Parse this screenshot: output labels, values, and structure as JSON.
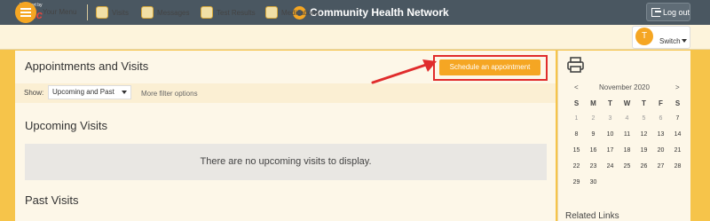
{
  "header": {
    "logo": {
      "small_text": "MyChart by",
      "brand_text": "Epic"
    },
    "brand_name": "Community Health Network",
    "logout_label": "Log out"
  },
  "nav": {
    "your_menu": "Your Menu",
    "items": [
      {
        "label": "Visits",
        "icon": "visits-icon"
      },
      {
        "label": "Messages",
        "icon": "messages-icon"
      },
      {
        "label": "Test Results",
        "icon": "test-results-icon"
      },
      {
        "label": "Medications",
        "icon": "medications-icon"
      }
    ],
    "switch": {
      "avatar_letter": "T",
      "label": "Switch"
    }
  },
  "main": {
    "title": "Appointments and Visits",
    "schedule_button": "Schedule an appointment",
    "filter": {
      "show_label": "Show:",
      "selected": "Upcoming and Past",
      "more_filters": "More filter options"
    },
    "upcoming_title": "Upcoming Visits",
    "upcoming_empty": "There are no upcoming visits to display.",
    "past_title": "Past Visits"
  },
  "sidebar": {
    "calendar": {
      "prev": "<",
      "month": "November 2020",
      "next": ">",
      "day_headers": [
        "S",
        "M",
        "T",
        "W",
        "T",
        "F",
        "S"
      ],
      "weeks": [
        [
          "1",
          "2",
          "3",
          "4",
          "5",
          "6",
          "7"
        ],
        [
          "8",
          "9",
          "10",
          "11",
          "12",
          "13",
          "14"
        ],
        [
          "15",
          "16",
          "17",
          "18",
          "19",
          "20",
          "21"
        ],
        [
          "22",
          "23",
          "24",
          "25",
          "26",
          "27",
          "28"
        ],
        [
          "29",
          "30",
          "",
          "",
          "",
          "",
          ""
        ]
      ],
      "past_days": [
        "1",
        "2",
        "3",
        "4",
        "5",
        "6"
      ]
    },
    "related_links": "Related Links"
  },
  "colors": {
    "accent": "#f5a623",
    "header_bg": "#4a5761",
    "highlight_border": "#e02c2c",
    "page_bg": "#fdf7e8"
  }
}
